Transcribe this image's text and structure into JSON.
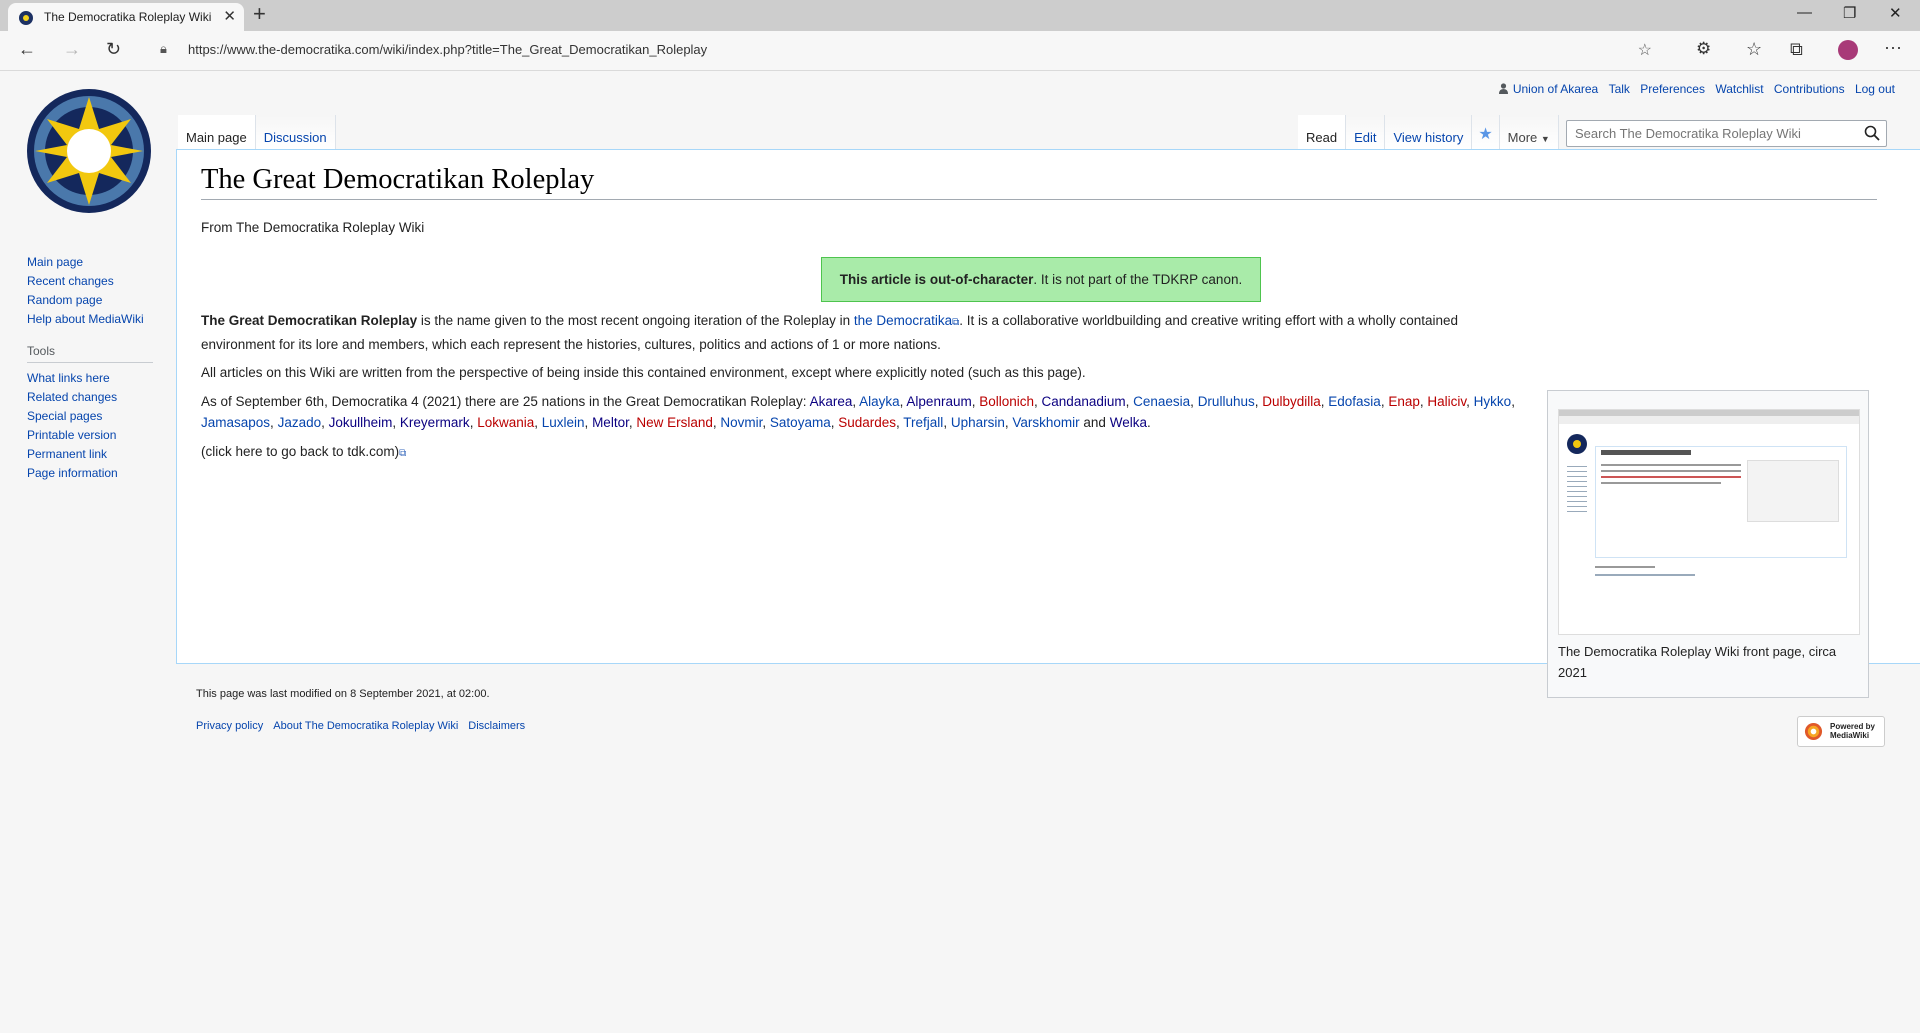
{
  "browser": {
    "tab_title": "The Democratika Roleplay Wiki",
    "url": "https://www.the-democratika.com/wiki/index.php?title=The_Great_Democratikan_Roleplay"
  },
  "personal": {
    "username": "Union of Akarea",
    "talk": "Talk",
    "preferences": "Preferences",
    "watchlist": "Watchlist",
    "contributions": "Contributions",
    "logout": "Log out"
  },
  "tabs": {
    "main_page": "Main page",
    "discussion": "Discussion",
    "read": "Read",
    "edit": "Edit",
    "view_history": "View history",
    "more": "More"
  },
  "search": {
    "placeholder": "Search The Democratika Roleplay Wiki"
  },
  "sidebar": {
    "nav": [
      "Main page",
      "Recent changes",
      "Random page",
      "Help about MediaWiki"
    ],
    "tools_heading": "Tools",
    "tools": [
      "What links here",
      "Related changes",
      "Special pages",
      "Printable version",
      "Permanent link",
      "Page information"
    ]
  },
  "article": {
    "title": "The Great Democratikan Roleplay",
    "site_sub": "From The Democratika Roleplay Wiki",
    "ooc_bold": "This article is out-of-character",
    "ooc_rest": ". It is not part of the TDKRP canon.",
    "p1_bold": "The Great Democratikan Roleplay",
    "p1_a": " is the name given to the most recent ongoing iteration of the Roleplay in ",
    "p1_link": "the Democratika",
    "p1_b": ". It is a collaborative worldbuilding and creative writing effort with a wholly contained environment for its lore and members, which each represent the histories, cultures, politics and actions of 1 or more nations.",
    "p2": "All articles on this Wiki are written from the perspective of being inside this contained environment, except where explicitly noted (such as this page).",
    "p3_intro": "As of September 6th, Democratika 4 (2021) there are 25 nations in the Great Democratikan Roleplay: ",
    "nations": [
      {
        "name": "Akarea",
        "status": "darkblue"
      },
      {
        "name": "Alayka",
        "status": "blue"
      },
      {
        "name": "Alpenraum",
        "status": "darkblue"
      },
      {
        "name": "Bollonich",
        "status": "red"
      },
      {
        "name": "Candanadium",
        "status": "darkblue"
      },
      {
        "name": "Cenaesia",
        "status": "blue"
      },
      {
        "name": "Drulluhus",
        "status": "blue"
      },
      {
        "name": "Dulbydilla",
        "status": "red"
      },
      {
        "name": "Edofasia",
        "status": "blue"
      },
      {
        "name": "Enap",
        "status": "red"
      },
      {
        "name": "Haliciv",
        "status": "red"
      },
      {
        "name": "Hykko",
        "status": "blue"
      },
      {
        "name": "Jamasapos",
        "status": "blue"
      },
      {
        "name": "Jazado",
        "status": "blue"
      },
      {
        "name": "Jokullheim",
        "status": "darkblue"
      },
      {
        "name": "Kreyermark",
        "status": "darkblue"
      },
      {
        "name": "Lokwania",
        "status": "red"
      },
      {
        "name": "Luxlein",
        "status": "blue"
      },
      {
        "name": "Meltor",
        "status": "darkblue"
      },
      {
        "name": "New Ersland",
        "status": "red"
      },
      {
        "name": "Novmir",
        "status": "blue"
      },
      {
        "name": "Satoyama",
        "status": "blue"
      },
      {
        "name": "Sudardes",
        "status": "red"
      },
      {
        "name": "Trefjall",
        "status": "blue"
      },
      {
        "name": "Upharsin",
        "status": "blue"
      },
      {
        "name": "Varskhomir",
        "status": "blue"
      },
      {
        "name": "Welka",
        "status": "darkblue"
      }
    ],
    "and_word": "and",
    "back_link": "(click here to go back to tdk.com)",
    "thumb_caption": "The Democratika Roleplay Wiki front page, circa 2021"
  },
  "footer": {
    "last_modified": "This page was last modified on 8 September 2021, at 02:00.",
    "links": [
      "Privacy policy",
      "About The Democratika Roleplay Wiki",
      "Disclaimers"
    ],
    "powered_by": "Powered by",
    "mediawiki": "MediaWiki"
  },
  "colors": {
    "link": "#0645ad",
    "visited": "#0b0080",
    "redlink": "#ba0000",
    "ooc_bg": "#a9eba9"
  }
}
